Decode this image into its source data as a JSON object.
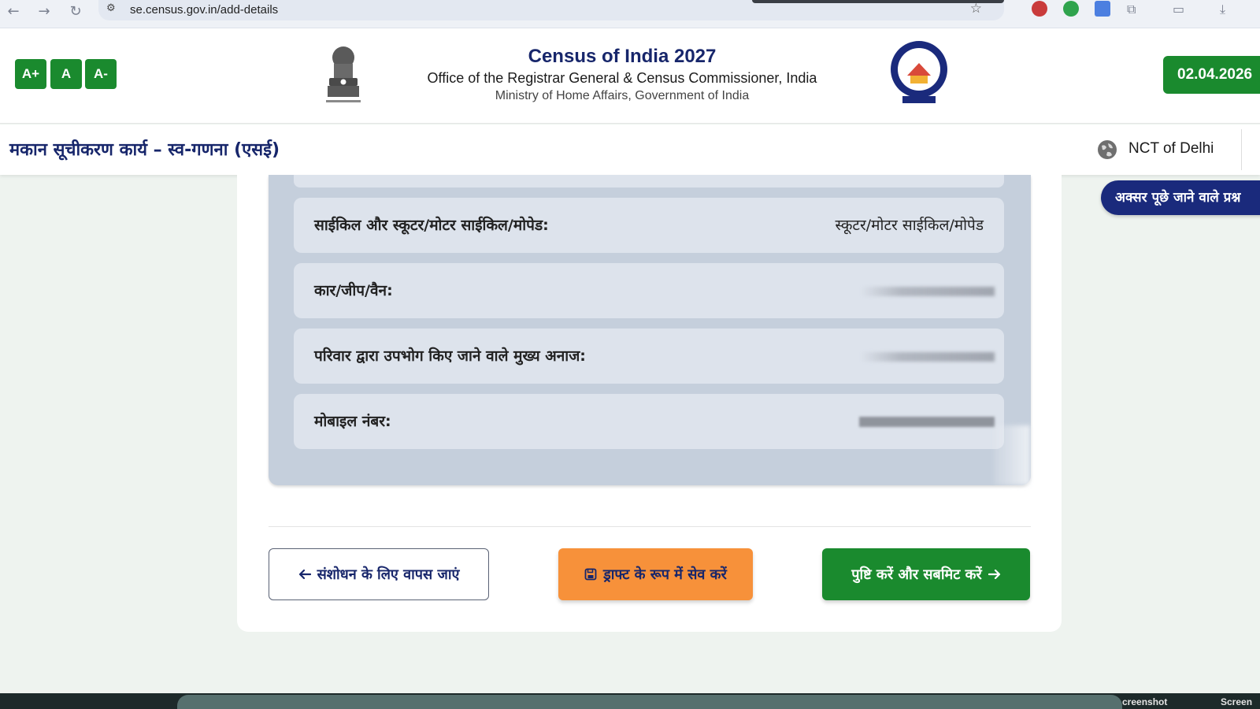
{
  "browser": {
    "url": "se.census.gov.in/add-details"
  },
  "header": {
    "font_buttons": [
      "A+",
      "A",
      "A-"
    ],
    "title": "Census of India 2027",
    "subtitle": "Office of the Registrar General & Census Commissioner, India",
    "ministry": "Ministry of Home Affairs, Government of India",
    "date": "02.04.2026"
  },
  "subheader": {
    "title": "मकान सूचीकरण कार्य – स्व-गणना (एसई)",
    "state": "NCT of Delhi"
  },
  "faq_label": "अक्सर पूछे जाने वाले प्रश्न",
  "review_rows": [
    {
      "label": "साईकिल और स्कूटर/मोटर साईकिल/मोपेड:",
      "value": "स्कूटर/मोटर साईकिल/मोपेड"
    },
    {
      "label": "कार/जीप/वैन:",
      "value": ""
    },
    {
      "label": "परिवार द्वारा उपभोग किए जाने वाले मुख्य अनाज:",
      "value": ""
    },
    {
      "label": "मोबाइल नंबर:",
      "value": ""
    }
  ],
  "actions": {
    "back_label": "संशोधन के लिए वापस जाएं",
    "draft_label": "ड्राफ्ट के रूप में सेव करें",
    "submit_label": "पुष्टि करें और सबमिट करें"
  },
  "taskbar": {
    "items": [
      "creenshot",
      "Screen"
    ]
  },
  "colors": {
    "brand_green": "#1a8a2e",
    "navy": "#17266b",
    "orange": "#f7913a"
  }
}
